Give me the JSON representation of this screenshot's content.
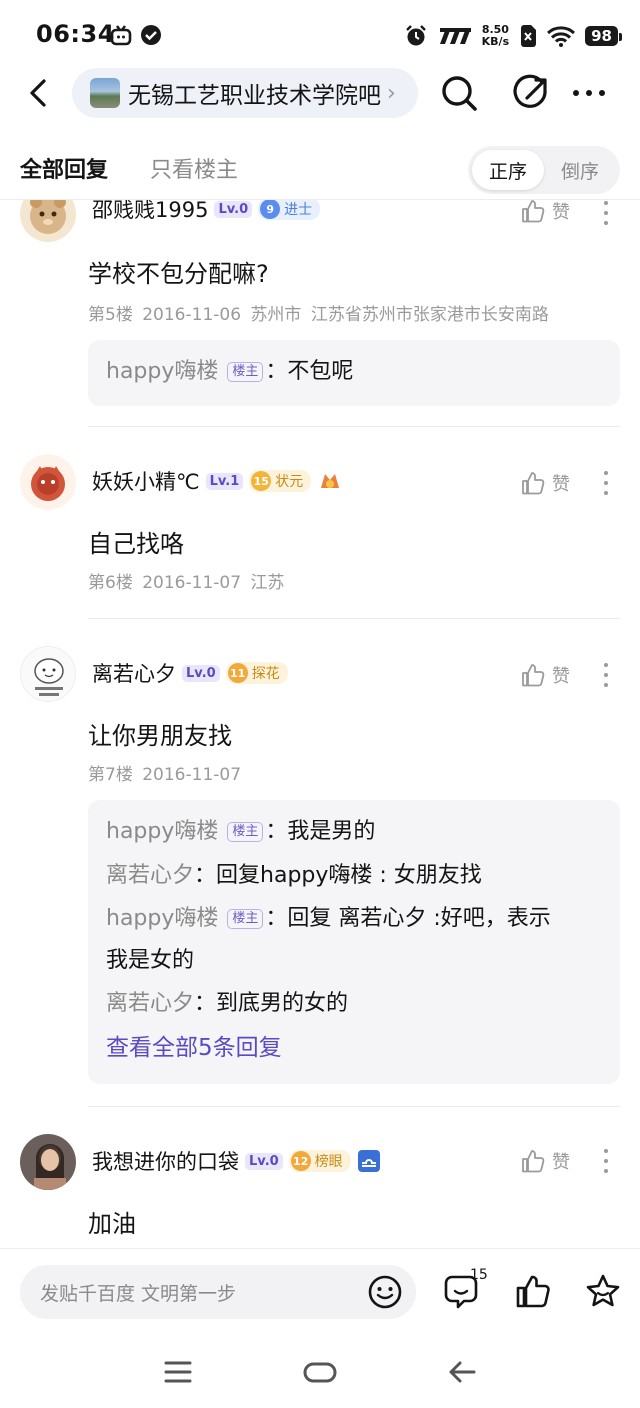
{
  "status_bar": {
    "time": "06:34",
    "net_speed_value": "8.50",
    "net_speed_unit": "KB/s",
    "battery": "98"
  },
  "header": {
    "forum_name": "无锡工艺职业技术学院吧",
    "chevron": "›"
  },
  "tabs": {
    "all_replies": "全部回复",
    "owner_only": "只看楼主",
    "order_asc": "正序",
    "order_desc": "倒序"
  },
  "like_label": "赞",
  "owner_tag": "楼主",
  "posts": [
    {
      "username": "邵贱贱1995",
      "level": "Lv.0",
      "title_num": "9",
      "title": "进士",
      "title_color": "#5b8def",
      "body": "学校不包分配嘛?",
      "floor": "第5楼",
      "date": "2016-11-06",
      "location": "苏州市 江苏省苏州市张家港市长安南路",
      "replies": [
        {
          "name": "happy嗨楼",
          "is_owner": true,
          "text": "不包呢"
        }
      ]
    },
    {
      "username": "妖妖小精℃",
      "level": "Lv.1",
      "title_num": "15",
      "title": "状元",
      "title_color": "#f2b53a",
      "body": "自己找咯",
      "floor": "第6楼",
      "date": "2016-11-07",
      "location": "江苏"
    },
    {
      "username": "离若心夕",
      "level": "Lv.0",
      "title_num": "11",
      "title": "探花",
      "title_color": "#f2a93a",
      "body": "让你男朋友找",
      "floor": "第7楼",
      "date": "2016-11-07",
      "location": "",
      "replies": [
        {
          "name": "happy嗨楼",
          "is_owner": true,
          "text": "我是男的"
        },
        {
          "name": "离若心夕",
          "is_owner": false,
          "text": "回复happy嗨楼 :  女朋友找"
        },
        {
          "name": "happy嗨楼",
          "is_owner": true,
          "text_line1": "回复 离若心夕 :好吧，表示",
          "text_line2": "我是女的"
        },
        {
          "name": "离若心夕",
          "is_owner": false,
          "text": "到底男的女的"
        }
      ],
      "view_all": "查看全部5条回复"
    },
    {
      "username": "我想进你的口袋",
      "level": "Lv.0",
      "title_num": "12",
      "title": "榜眼",
      "title_color": "#f2a93a",
      "body": "加油"
    }
  ],
  "bottom_bar": {
    "input_placeholder": "发贴千百度 文明第一步",
    "comment_count": "15"
  },
  "colors": {
    "accent": "#5a4bc4",
    "muted": "#9a9a9a"
  }
}
